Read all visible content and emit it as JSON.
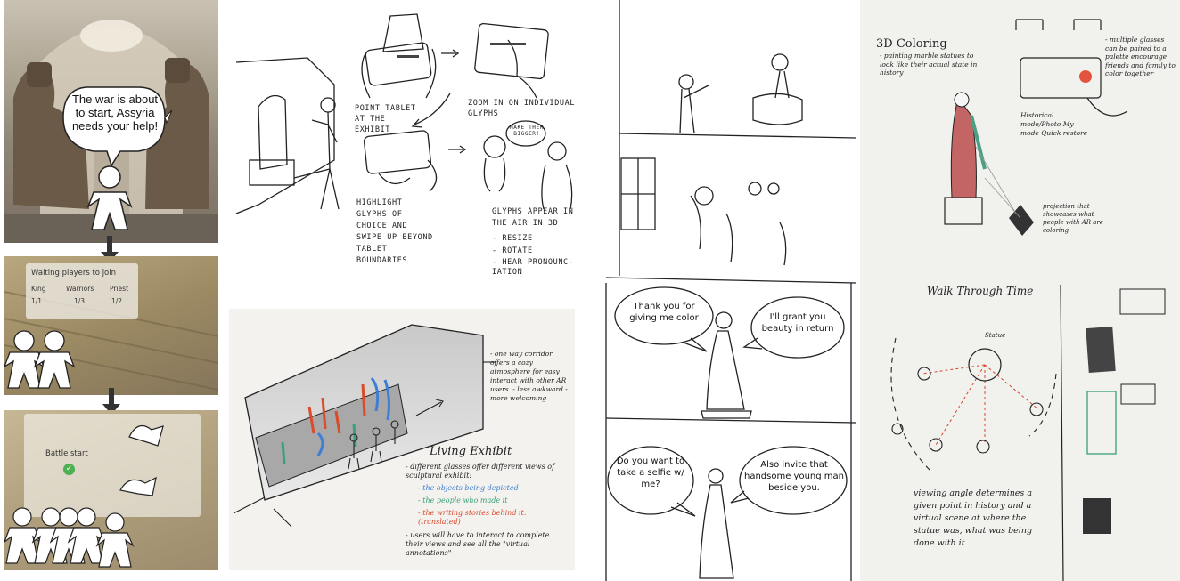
{
  "panel1": {
    "speech": "The war is about to start, Assyria needs your help!",
    "lobby": {
      "title": "Waiting players to join",
      "roles": [
        {
          "name": "King",
          "count": "1/1"
        },
        {
          "name": "Warriors",
          "count": "1/3"
        },
        {
          "name": "Priest",
          "count": "1/2"
        }
      ]
    },
    "battle": {
      "label": "Battle start"
    }
  },
  "panel2": {
    "step1": "POINT TABLET AT THE EXHIBIT",
    "step2": "ZOOM IN ON INDIVIDUAL GLYPHS",
    "step3": "HIGHLIGHT GLYPHS OF CHOICE AND SWIPE UP BEYOND TABLET BOUNDARIES",
    "step4_title": "GLYPHS APPEAR IN THE AIR IN 3D",
    "step4_items": [
      "- RESIZE",
      "- ROTATE",
      "- HEAR PRONOUNC- IATION"
    ],
    "bubble": "MAKE THEM BIGGER!"
  },
  "panel3": {
    "title": "Living Exhibit",
    "side_note": "- one way corridor offers a cozy atmosphere for easy interact with other AR users. - less awkward - more welcoming",
    "notes": [
      {
        "text": "- different glasses offer different views of sculptural exhibit:",
        "color": "#222222"
      },
      {
        "text": "- the objects being depicted",
        "color": "#3d7fd4"
      },
      {
        "text": "- the people who made it",
        "color": "#3aa07a"
      },
      {
        "text": "- the writing stories behind it. (translated)",
        "color": "#d9462b"
      },
      {
        "text": "- users will have to interact to complete their views and see all the \"virtual annotations\"",
        "color": "#222222"
      }
    ]
  },
  "panel4": {
    "bubble1": "Thank you for giving me color",
    "bubble2": "I'll grant you beauty in return",
    "bubble3": "Do you want to take a selfie w/ me?",
    "bubble4": "Also invite that handsome young man beside you."
  },
  "panel5": {
    "title1": "3D Coloring",
    "note1": "- painting marble statues to look like their actual state in history",
    "note2": "- multiple glasses can be paired to a palette encourage friends and family to color together",
    "note3": "Historical mode/Photo My mode Quick restore",
    "note4": "projection that showcases what people with AR are coloring",
    "title2": "Walk Through Time",
    "statue_label": "Statue",
    "note5": "viewing angle determines a given point in history and a virtual scene at where the statue was, what was being done with it"
  }
}
